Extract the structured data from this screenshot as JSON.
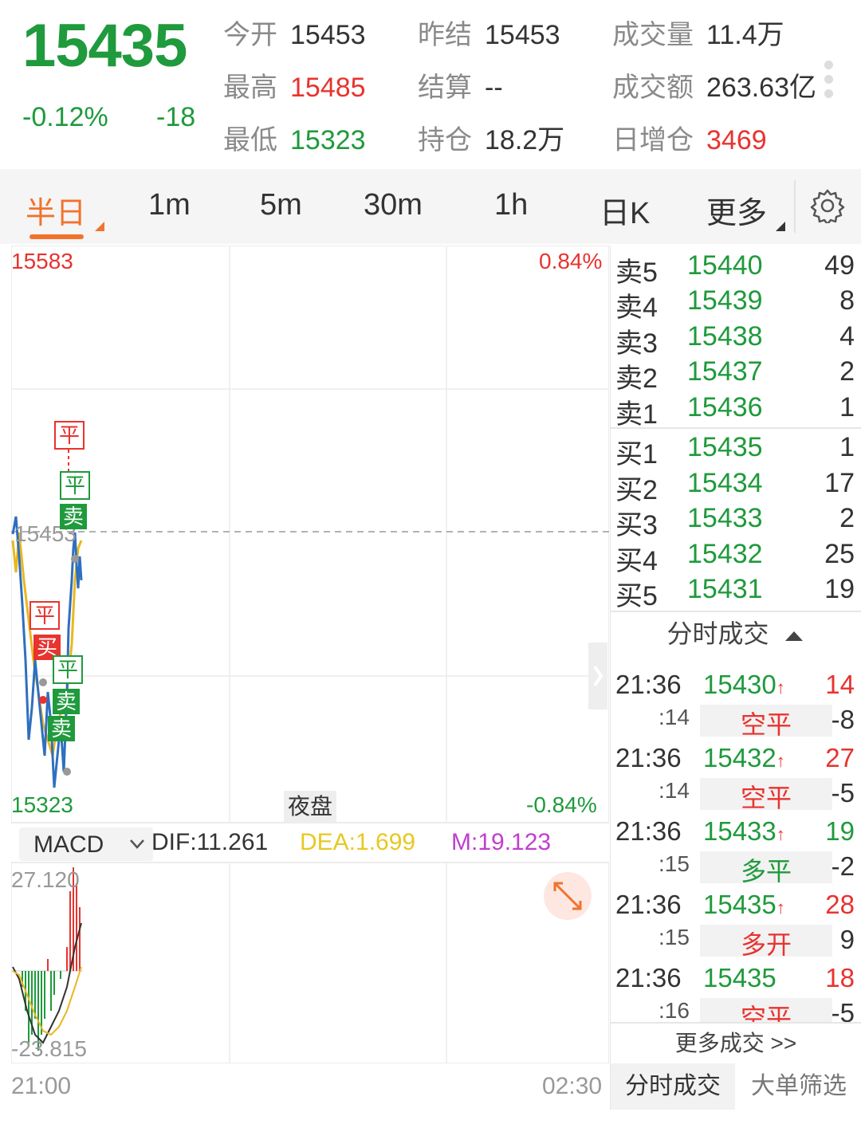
{
  "quote": {
    "price": "15435",
    "change_pct": "-0.12%",
    "change_abs": "-18",
    "stats": [
      {
        "label": "今开",
        "value": "15453",
        "tone": "k"
      },
      {
        "label": "昨结",
        "value": "15453",
        "tone": "k"
      },
      {
        "label": "成交量",
        "value": "11.4万",
        "tone": "k"
      },
      {
        "label": "最高",
        "value": "15485",
        "tone": "r"
      },
      {
        "label": "结算",
        "value": "--",
        "tone": "k"
      },
      {
        "label": "成交额",
        "value": "263.63亿",
        "tone": "k"
      },
      {
        "label": "最低",
        "value": "15323",
        "tone": "g"
      },
      {
        "label": "持仓",
        "value": "18.2万",
        "tone": "k"
      },
      {
        "label": "日增仓",
        "value": "3469",
        "tone": "r"
      }
    ]
  },
  "tabs": [
    {
      "label": "半日",
      "active": true
    },
    {
      "label": "1m"
    },
    {
      "label": "5m"
    },
    {
      "label": "30m"
    },
    {
      "label": "1h"
    },
    {
      "label": "日K"
    },
    {
      "label": "更多"
    }
  ],
  "chart": {
    "y_high": "15583",
    "y_low": "15323",
    "ref_price": "15453",
    "pct_high": "0.84%",
    "pct_low": "-0.84%",
    "session_label": "夜盘",
    "time_start": "21:00",
    "time_end": "02:30",
    "marks": [
      "平",
      "平",
      "卖",
      "平",
      "买",
      "平",
      "卖",
      "卖"
    ]
  },
  "macd": {
    "indicator": "MACD",
    "dif": "DIF:11.261",
    "dea": "DEA:1.699",
    "m": "M:19.123",
    "y_high": "27.120",
    "y_low": "-23.815"
  },
  "order_book": {
    "asks": [
      {
        "side": "卖5",
        "price": "15440",
        "vol": "49"
      },
      {
        "side": "卖4",
        "price": "15439",
        "vol": "8"
      },
      {
        "side": "卖3",
        "price": "15438",
        "vol": "4"
      },
      {
        "side": "卖2",
        "price": "15437",
        "vol": "2"
      },
      {
        "side": "卖1",
        "price": "15436",
        "vol": "1"
      }
    ],
    "bids": [
      {
        "side": "买1",
        "price": "15435",
        "vol": "1"
      },
      {
        "side": "买2",
        "price": "15434",
        "vol": "17"
      },
      {
        "side": "买3",
        "price": "15433",
        "vol": "2"
      },
      {
        "side": "买4",
        "price": "15432",
        "vol": "25"
      },
      {
        "side": "买5",
        "price": "15431",
        "vol": "19"
      }
    ]
  },
  "trades": {
    "header": "分时成交",
    "rows": [
      {
        "time": "21:36",
        "price": "15430",
        "vol": "14",
        "sec": ":14",
        "type": "空平",
        "tvol": "-8"
      },
      {
        "time": "21:36",
        "price": "15432",
        "vol": "27",
        "sec": ":14",
        "type": "空平",
        "tvol": "-5"
      },
      {
        "time": "21:36",
        "price": "15433",
        "vol": "19",
        "sec": ":15",
        "type": "多平",
        "tvol": "-2"
      },
      {
        "time": "21:36",
        "price": "15435",
        "vol": "28",
        "sec": ":15",
        "type": "多开",
        "tvol": "9"
      },
      {
        "time": "21:36",
        "price": "15435",
        "vol": "18",
        "sec": ":16",
        "type": "空平",
        "tvol": "-5"
      }
    ],
    "more": "更多成交 >>"
  },
  "bottom_tabs": [
    "分时成交",
    "大单筛选"
  ],
  "colors": {
    "up": "#e8332f",
    "down": "#1f9a3c",
    "accent": "#f2722c",
    "price_line": "#2f6fbf",
    "avg_line": "#e8b820"
  }
}
